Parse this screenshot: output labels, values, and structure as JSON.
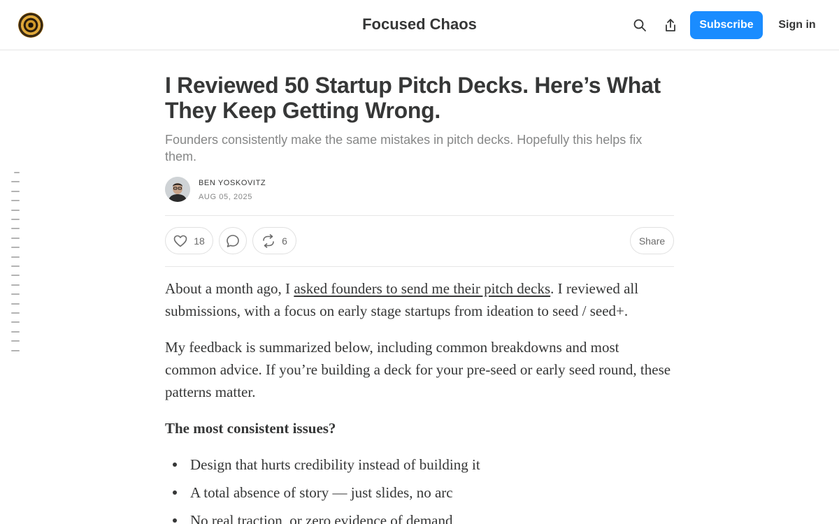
{
  "header": {
    "site_title": "Focused Chaos",
    "subscribe_label": "Subscribe",
    "signin_label": "Sign in",
    "icons": [
      "logo",
      "search-icon",
      "share-icon"
    ]
  },
  "colors": {
    "accent": "#1a8cff",
    "text": "#363737",
    "muted": "#868787",
    "border": "#e6e6e6"
  },
  "article": {
    "title": "I Reviewed 50 Startup Pitch Decks. Here’s What They Keep Getting Wrong.",
    "subtitle": "Founders consistently make the same mistakes in pitch decks. Hopefully this helps fix them.",
    "author": "BEN YOSKOVITZ",
    "date": "AUG 05, 2025",
    "actions": {
      "like_count": "18",
      "restack_count": "6",
      "share_label": "Share"
    },
    "body": {
      "p1_before_link": "About a month ago, I ",
      "p1_link": "asked founders to send me their pitch decks",
      "p1_after_link": ". I reviewed all submissions, with a focus on early stage startups from ideation to seed / seed+.",
      "p2": "My feedback is summarized below, including common breakdowns and most common advice. If you’re building a deck for your pre-seed or early seed round, these patterns matter.",
      "heading": "The most consistent issues?",
      "bullets": [
        "Design that hurts credibility instead of building it",
        "A total absence of story — just slides, no arc",
        "No real traction, or zero evidence of demand"
      ]
    }
  },
  "toc": {
    "tick_count": 20
  }
}
